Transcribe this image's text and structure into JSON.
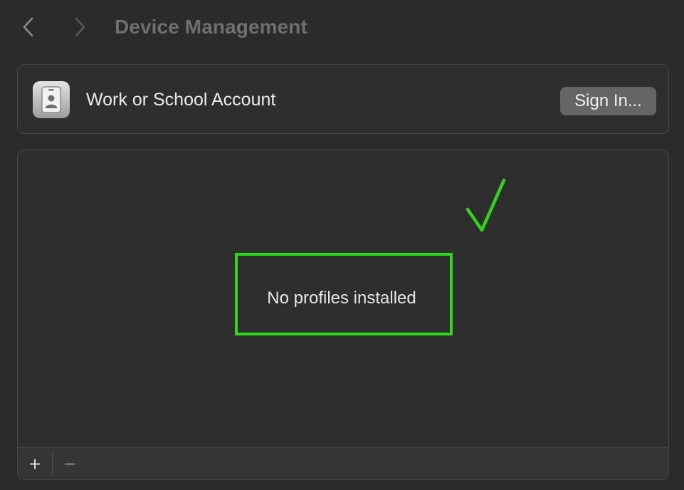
{
  "header": {
    "title": "Device Management",
    "back_icon": "chevron-left-icon",
    "forward_icon": "chevron-right-icon"
  },
  "account": {
    "icon": "id-badge-icon",
    "label": "Work or School Account",
    "sign_in_label": "Sign In..."
  },
  "profiles": {
    "empty_message": "No profiles installed",
    "add_symbol": "+",
    "remove_symbol": "−"
  },
  "annotations": {
    "highlight_color": "#2bd916",
    "checkmark_icon": "checkmark-icon"
  },
  "colors": {
    "background": "#2b2b2b",
    "panel": "#2e2e2e",
    "button": "#656565",
    "title": "#6f6f6f"
  }
}
